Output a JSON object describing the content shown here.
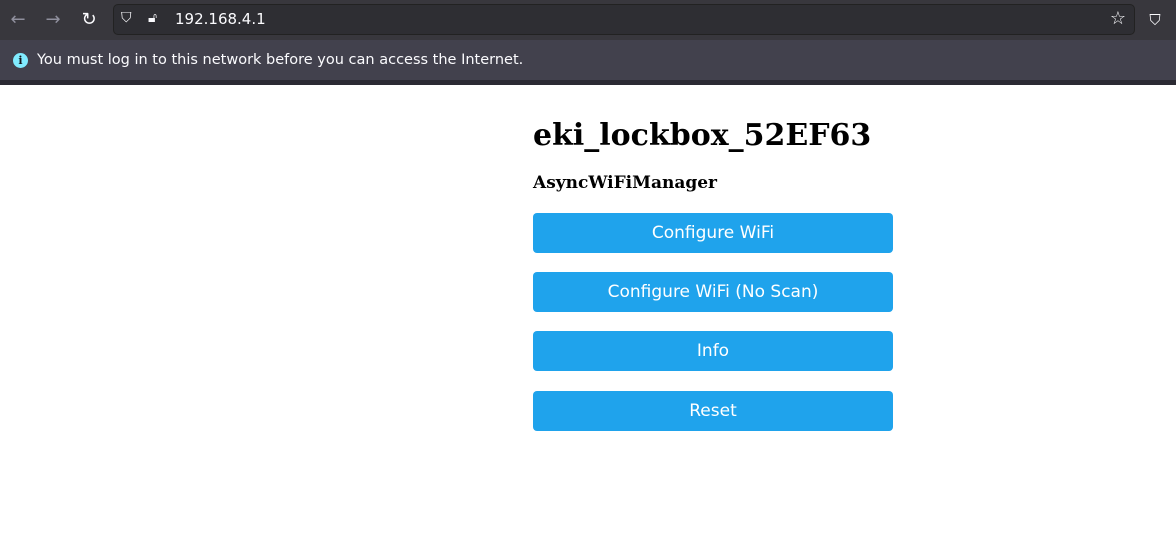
{
  "browser": {
    "url": "192.168.4.1",
    "icons": [
      "back-arrow-icon",
      "forward-arrow-icon",
      "reload-icon",
      "shield-icon",
      "insecure-lock-icon",
      "star-icon",
      "pocket-icon"
    ]
  },
  "notification": {
    "text": "You must log in to this network before you can access the Internet."
  },
  "page": {
    "title": "eki_lockbox_52EF63",
    "subtitle": "AsyncWiFiManager",
    "buttons": [
      "Configure WiFi",
      "Configure WiFi (No Scan)",
      "Info",
      "Reset"
    ],
    "button_color": "#1fa3ec"
  }
}
